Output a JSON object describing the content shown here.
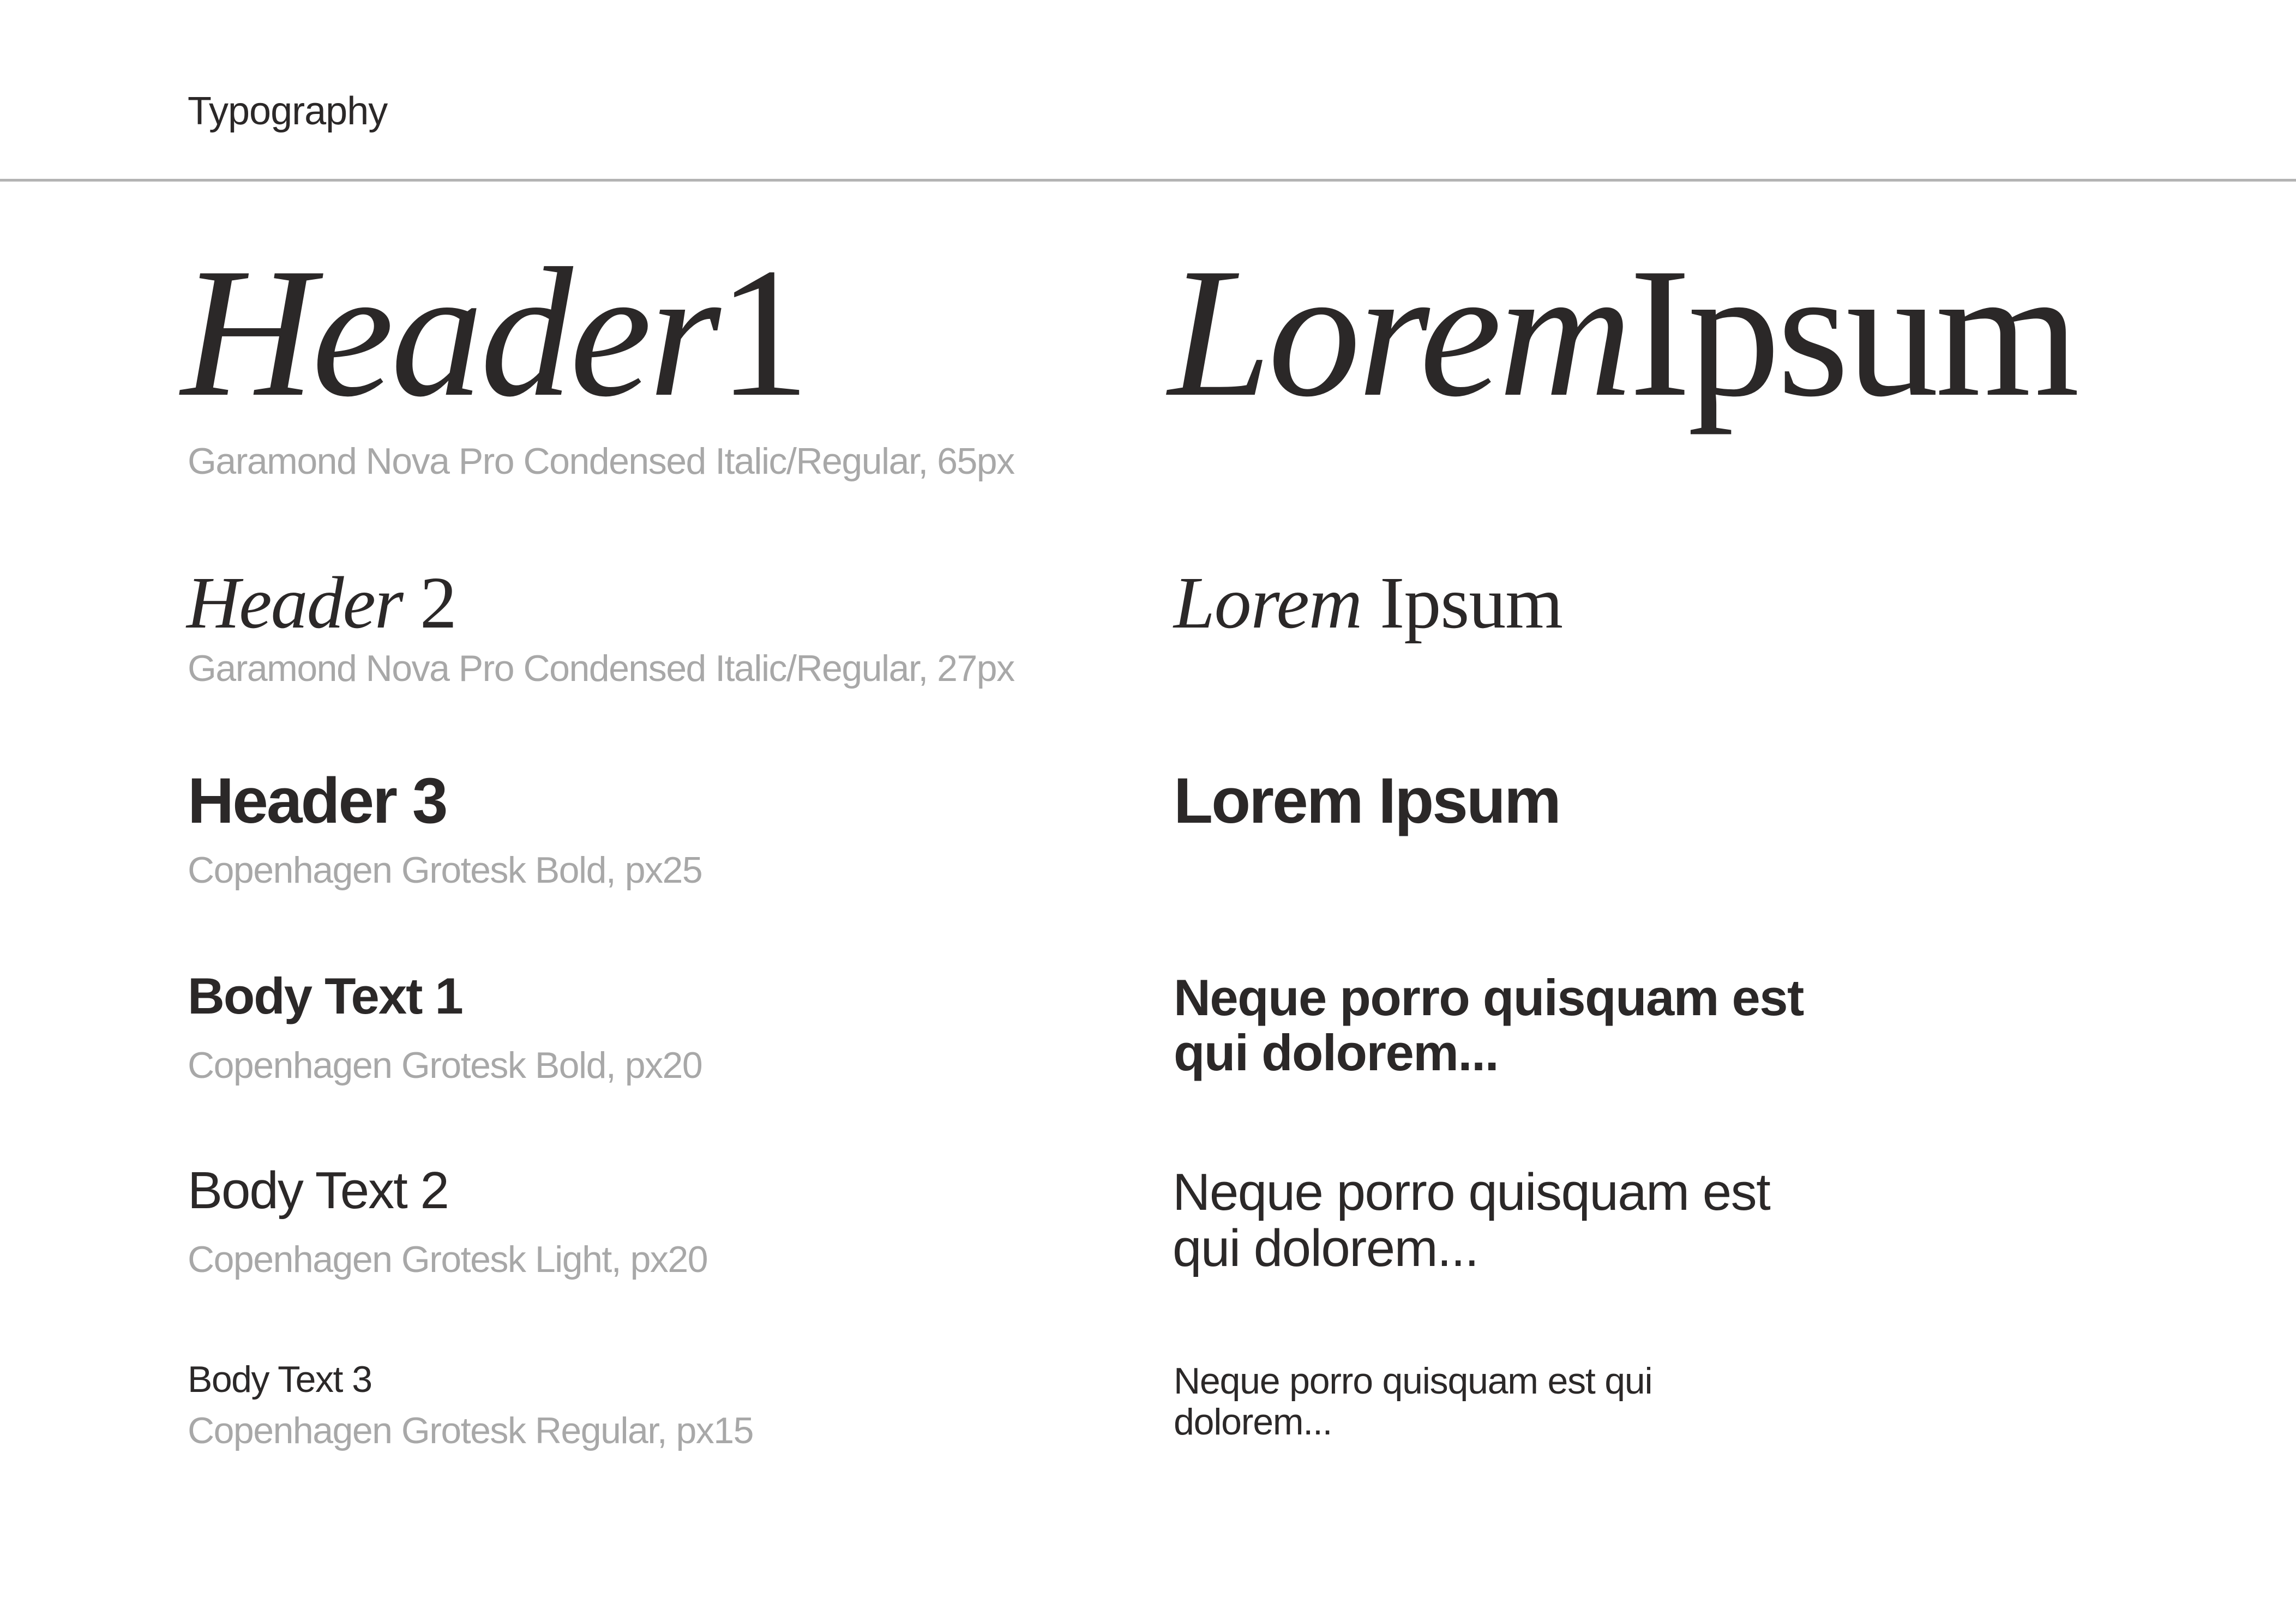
{
  "page": {
    "title": "Typography"
  },
  "styles": [
    {
      "id": "header1",
      "label_italic": "Header",
      "label_regular": "1",
      "sample_italic": "Lorem",
      "sample_regular": "Ipsum",
      "caption": "Garamond Nova Pro Condensed Italic/Regular, 65px"
    },
    {
      "id": "header2",
      "label_italic": "Header",
      "label_regular": " 2",
      "sample_italic": "Lorem",
      "sample_regular": " Ipsum",
      "caption": "Garamond Nova Pro Condensed Italic/Regular, 27px"
    },
    {
      "id": "header3",
      "label": "Header 3",
      "sample": "Lorem Ipsum",
      "caption": "Copenhagen Grotesk Bold, px25"
    },
    {
      "id": "body1",
      "label": "Body Text 1",
      "sample": "Neque porro quisquam est qui dolorem...",
      "caption": "Copenhagen Grotesk Bold, px20"
    },
    {
      "id": "body2",
      "label": "Body Text 2",
      "sample": "Neque porro quisquam est qui dolorem...",
      "caption": "Copenhagen Grotesk Light, px20"
    },
    {
      "id": "body3",
      "label": "Body Text 3",
      "sample": "Neque porro quisquam est qui dolorem...",
      "caption": "Copenhagen Grotesk Regular, px15"
    }
  ],
  "colors": {
    "text": "#2b2828",
    "caption": "#a8a8a8",
    "rule": "#b3b3b3",
    "background": "#ffffff"
  }
}
